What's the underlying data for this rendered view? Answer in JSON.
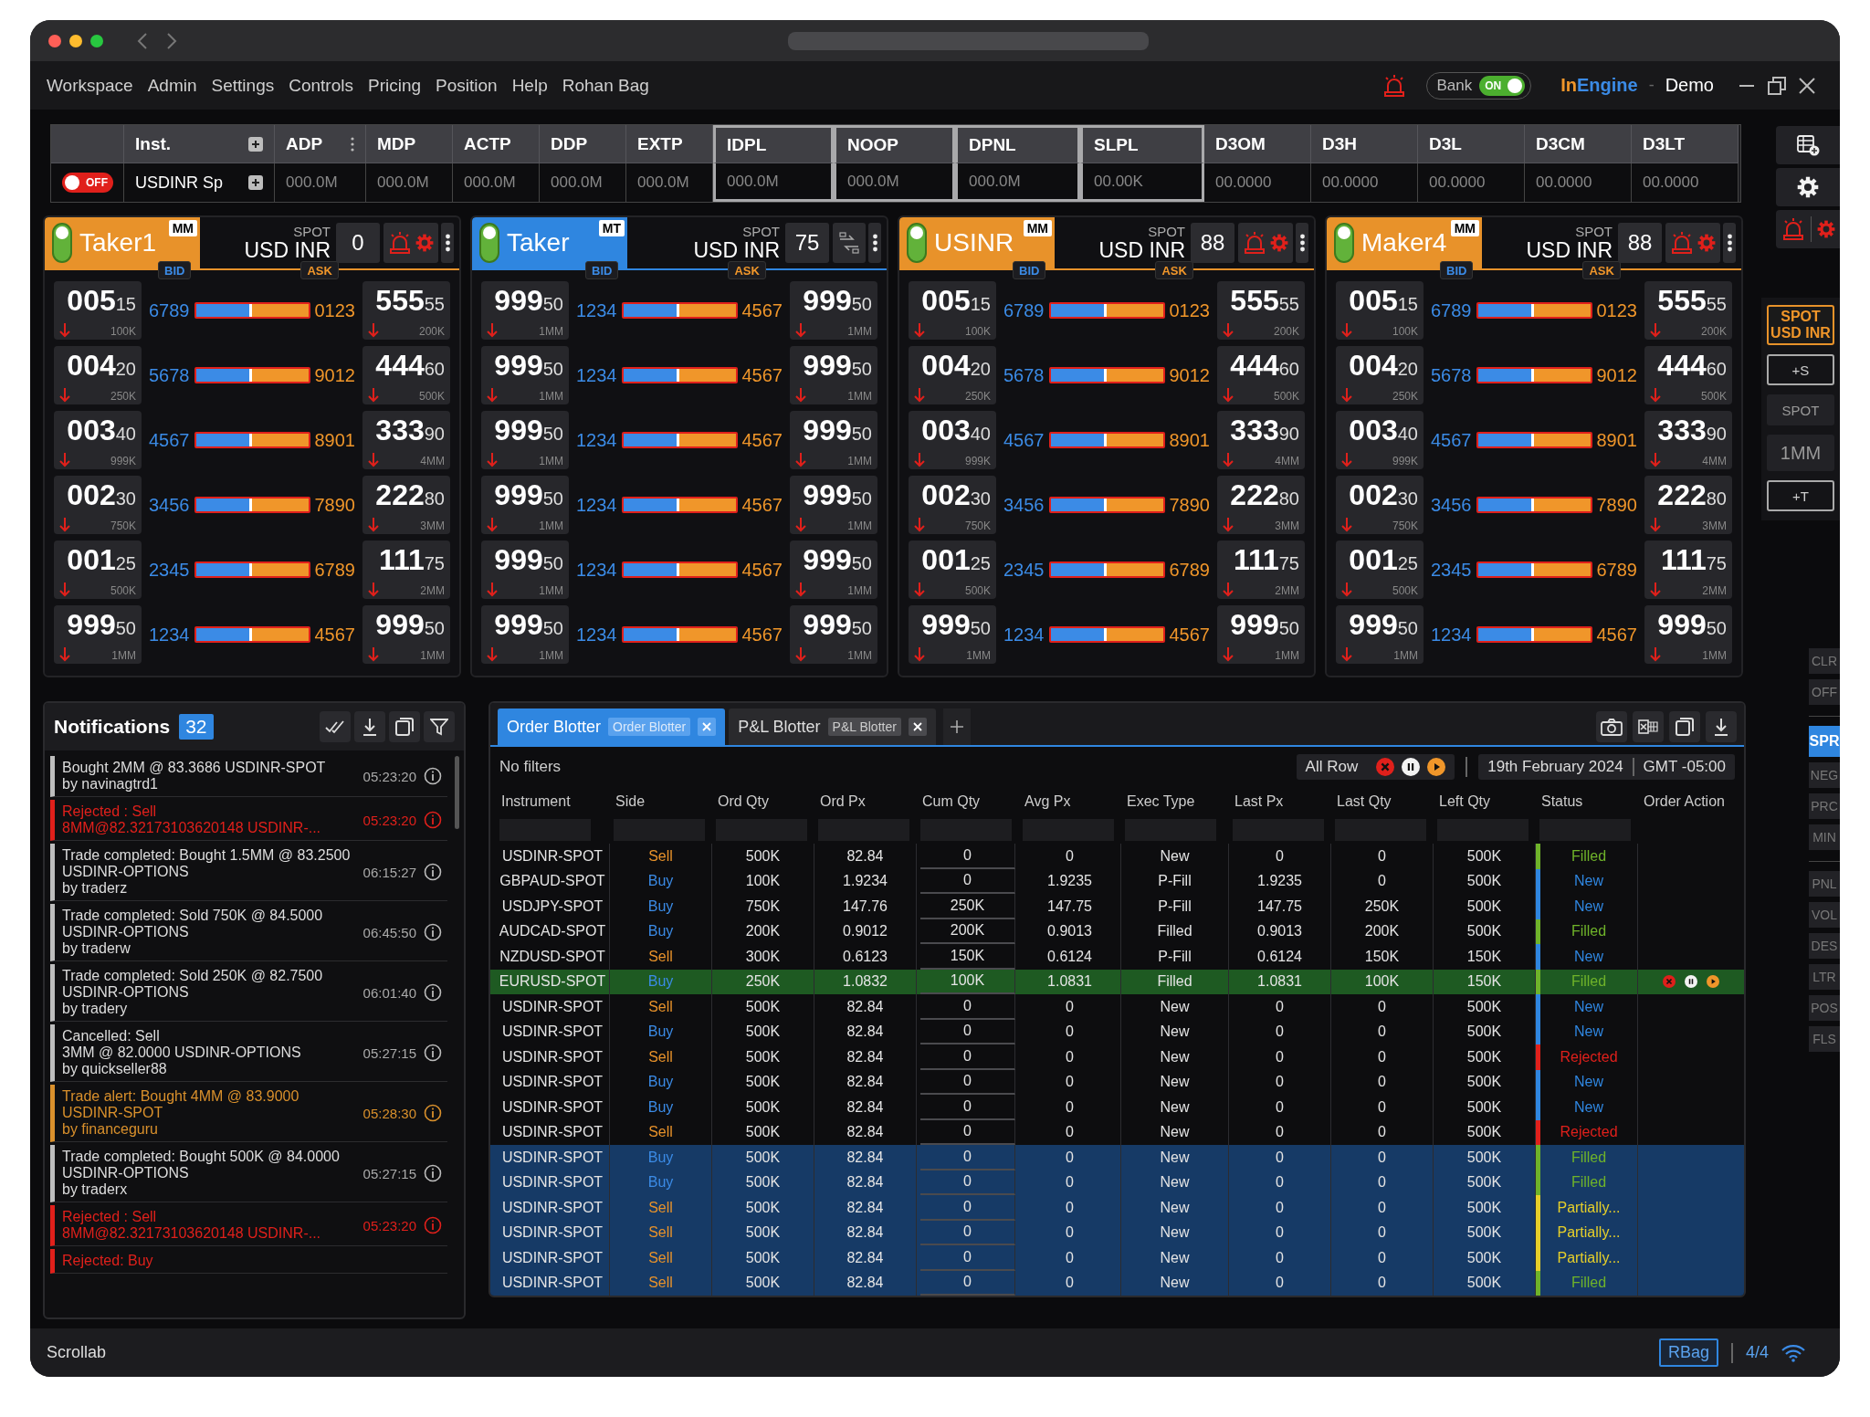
{
  "menu": [
    "Workspace",
    "Admin",
    "Settings",
    "Controls",
    "Pricing",
    "Position",
    "Help",
    "Rohan Bag"
  ],
  "header": {
    "bank_toggle": {
      "label": "Bank",
      "on": true,
      "state_label": "ON"
    },
    "brand": {
      "first": "In",
      "second": "Engine",
      "separator": "-",
      "environment": "Demo"
    }
  },
  "instrument_bar": {
    "toggle": {
      "on": false,
      "label": "OFF"
    },
    "columns": [
      {
        "label": "Inst.",
        "value": "USDINR Sp",
        "kind": "instrument",
        "boxed": false
      },
      {
        "label": "ADP",
        "value": "000.0M",
        "kind": "menu",
        "boxed": false
      },
      {
        "label": "MDP",
        "value": "000.0M",
        "kind": "plain",
        "boxed": false
      },
      {
        "label": "ACTP",
        "value": "000.0M",
        "kind": "plain",
        "boxed": false
      },
      {
        "label": "DDP",
        "value": "000.0M",
        "kind": "plain",
        "boxed": false
      },
      {
        "label": "EXTP",
        "value": "000.0M",
        "kind": "plain",
        "boxed": false
      },
      {
        "label": "IDPL",
        "value": "000.0M",
        "kind": "plain",
        "boxed": true
      },
      {
        "label": "NOOP",
        "value": "000.0M",
        "kind": "plain",
        "boxed": true
      },
      {
        "label": "DPNL",
        "value": "000.0M",
        "kind": "plain",
        "boxed": true
      },
      {
        "label": "SLPL",
        "value": "00.00K",
        "kind": "plain",
        "boxed": true
      },
      {
        "label": "D3OM",
        "value": "00.0000",
        "kind": "plain",
        "boxed": false
      },
      {
        "label": "D3H",
        "value": "00.0000",
        "kind": "plain",
        "boxed": false
      },
      {
        "label": "D3L",
        "value": "00.0000",
        "kind": "plain",
        "boxed": false
      },
      {
        "label": "D3CM",
        "value": "00.0000",
        "kind": "plain",
        "boxed": false
      },
      {
        "label": "D3LT",
        "value": "00.0000",
        "kind": "plain",
        "boxed": false
      }
    ]
  },
  "panels": [
    {
      "name": "Taker1",
      "tag": "MM",
      "color": "#e8922a",
      "product": "SPOT",
      "pair": "USD INR",
      "qty": "0",
      "kind": "alerts",
      "bid_label": "BID",
      "ask_label": "ASK",
      "rows": [
        {
          "bid": {
            "price": "005",
            "pips": "15",
            "size": "100K",
            "kind": "down"
          },
          "bid_qty": "6789",
          "level": 0.5,
          "ask_qty": "0123",
          "ask": {
            "price": "555",
            "pips": "55",
            "size": "200K",
            "kind": "down"
          }
        },
        {
          "bid": {
            "price": "004",
            "pips": "20",
            "size": "250K",
            "kind": "down"
          },
          "bid_qty": "5678",
          "level": 0.5,
          "ask_qty": "9012",
          "ask": {
            "price": "444",
            "pips": "60",
            "size": "500K",
            "kind": "down"
          }
        },
        {
          "bid": {
            "price": "003",
            "pips": "40",
            "size": "999K",
            "kind": "down"
          },
          "bid_qty": "4567",
          "level": 0.5,
          "ask_qty": "8901",
          "ask": {
            "price": "333",
            "pips": "90",
            "size": "4MM",
            "kind": "down"
          }
        },
        {
          "bid": {
            "price": "002",
            "pips": "30",
            "size": "750K",
            "kind": "down"
          },
          "bid_qty": "3456",
          "level": 0.5,
          "ask_qty": "7890",
          "ask": {
            "price": "222",
            "pips": "80",
            "size": "3MM",
            "kind": "down"
          }
        },
        {
          "bid": {
            "price": "001",
            "pips": "25",
            "size": "500K",
            "kind": "down"
          },
          "bid_qty": "2345",
          "level": 0.5,
          "ask_qty": "6789",
          "ask": {
            "price": "111",
            "pips": "75",
            "size": "2MM",
            "kind": "down"
          }
        },
        {
          "bid": {
            "price": "999",
            "pips": "50",
            "size": "1MM",
            "kind": "down"
          },
          "bid_qty": "1234",
          "level": 0.5,
          "ask_qty": "4567",
          "ask": {
            "price": "999",
            "pips": "50",
            "size": "1MM",
            "kind": "down"
          }
        }
      ]
    },
    {
      "name": "Taker",
      "tag": "MT",
      "color": "#2f86e0",
      "product": "SPOT",
      "pair": "USD INR",
      "qty": "75",
      "kind": "convert",
      "bid_label": "BID",
      "ask_label": "ASK",
      "rows": [
        {
          "bid": {
            "price": "999",
            "pips": "50",
            "size": "1MM",
            "kind": "down"
          },
          "bid_qty": "1234",
          "level": 0.5,
          "ask_qty": "4567",
          "ask": {
            "price": "999",
            "pips": "50",
            "size": "1MM",
            "kind": "down"
          }
        },
        {
          "bid": {
            "price": "999",
            "pips": "50",
            "size": "1MM",
            "kind": "down"
          },
          "bid_qty": "1234",
          "level": 0.5,
          "ask_qty": "4567",
          "ask": {
            "price": "999",
            "pips": "50",
            "size": "1MM",
            "kind": "down"
          }
        },
        {
          "bid": {
            "price": "999",
            "pips": "50",
            "size": "1MM",
            "kind": "down"
          },
          "bid_qty": "1234",
          "level": 0.5,
          "ask_qty": "4567",
          "ask": {
            "price": "999",
            "pips": "50",
            "size": "1MM",
            "kind": "down"
          }
        },
        {
          "bid": {
            "price": "999",
            "pips": "50",
            "size": "1MM",
            "kind": "down"
          },
          "bid_qty": "1234",
          "level": 0.5,
          "ask_qty": "4567",
          "ask": {
            "price": "999",
            "pips": "50",
            "size": "1MM",
            "kind": "down"
          }
        },
        {
          "bid": {
            "price": "999",
            "pips": "50",
            "size": "1MM",
            "kind": "down"
          },
          "bid_qty": "1234",
          "level": 0.5,
          "ask_qty": "4567",
          "ask": {
            "price": "999",
            "pips": "50",
            "size": "1MM",
            "kind": "down"
          }
        },
        {
          "bid": {
            "price": "999",
            "pips": "50",
            "size": "1MM",
            "kind": "down"
          },
          "bid_qty": "1234",
          "level": 0.5,
          "ask_qty": "4567",
          "ask": {
            "price": "999",
            "pips": "50",
            "size": "1MM",
            "kind": "down"
          }
        }
      ]
    },
    {
      "name": "USINR",
      "tag": "MM",
      "color": "#e8922a",
      "product": "SPOT",
      "pair": "USD INR",
      "qty": "88",
      "kind": "alerts",
      "bid_label": "BID",
      "ask_label": "ASK",
      "rows": [
        {
          "bid": {
            "price": "005",
            "pips": "15",
            "size": "100K",
            "kind": "down"
          },
          "bid_qty": "6789",
          "level": 0.5,
          "ask_qty": "0123",
          "ask": {
            "price": "555",
            "pips": "55",
            "size": "200K",
            "kind": "down"
          }
        },
        {
          "bid": {
            "price": "004",
            "pips": "20",
            "size": "250K",
            "kind": "down"
          },
          "bid_qty": "5678",
          "level": 0.5,
          "ask_qty": "9012",
          "ask": {
            "price": "444",
            "pips": "60",
            "size": "500K",
            "kind": "down"
          }
        },
        {
          "bid": {
            "price": "003",
            "pips": "40",
            "size": "999K",
            "kind": "down"
          },
          "bid_qty": "4567",
          "level": 0.5,
          "ask_qty": "8901",
          "ask": {
            "price": "333",
            "pips": "90",
            "size": "4MM",
            "kind": "down"
          }
        },
        {
          "bid": {
            "price": "002",
            "pips": "30",
            "size": "750K",
            "kind": "down"
          },
          "bid_qty": "3456",
          "level": 0.5,
          "ask_qty": "7890",
          "ask": {
            "price": "222",
            "pips": "80",
            "size": "3MM",
            "kind": "down"
          }
        },
        {
          "bid": {
            "price": "001",
            "pips": "25",
            "size": "500K",
            "kind": "down"
          },
          "bid_qty": "2345",
          "level": 0.5,
          "ask_qty": "6789",
          "ask": {
            "price": "111",
            "pips": "75",
            "size": "2MM",
            "kind": "down"
          }
        },
        {
          "bid": {
            "price": "999",
            "pips": "50",
            "size": "1MM",
            "kind": "down"
          },
          "bid_qty": "1234",
          "level": 0.5,
          "ask_qty": "4567",
          "ask": {
            "price": "999",
            "pips": "50",
            "size": "1MM",
            "kind": "down"
          }
        }
      ]
    },
    {
      "name": "Maker4",
      "tag": "MM",
      "color": "#e8922a",
      "product": "SPOT",
      "pair": "USD INR",
      "qty": "88",
      "kind": "alerts",
      "bid_label": "BID",
      "ask_label": "ASK",
      "rows": [
        {
          "bid": {
            "price": "005",
            "pips": "15",
            "size": "100K",
            "kind": "down"
          },
          "bid_qty": "6789",
          "level": 0.5,
          "ask_qty": "0123",
          "ask": {
            "price": "555",
            "pips": "55",
            "size": "200K",
            "kind": "down"
          }
        },
        {
          "bid": {
            "price": "004",
            "pips": "20",
            "size": "250K",
            "kind": "down"
          },
          "bid_qty": "5678",
          "level": 0.5,
          "ask_qty": "9012",
          "ask": {
            "price": "444",
            "pips": "60",
            "size": "500K",
            "kind": "down"
          }
        },
        {
          "bid": {
            "price": "003",
            "pips": "40",
            "size": "999K",
            "kind": "down"
          },
          "bid_qty": "4567",
          "level": 0.5,
          "ask_qty": "8901",
          "ask": {
            "price": "333",
            "pips": "90",
            "size": "4MM",
            "kind": "down"
          }
        },
        {
          "bid": {
            "price": "002",
            "pips": "30",
            "size": "750K",
            "kind": "down"
          },
          "bid_qty": "3456",
          "level": 0.5,
          "ask_qty": "7890",
          "ask": {
            "price": "222",
            "pips": "80",
            "size": "3MM",
            "kind": "down"
          }
        },
        {
          "bid": {
            "price": "001",
            "pips": "25",
            "size": "500K",
            "kind": "down"
          },
          "bid_qty": "2345",
          "level": 0.5,
          "ask_qty": "6789",
          "ask": {
            "price": "111",
            "pips": "75",
            "size": "2MM",
            "kind": "down"
          }
        },
        {
          "bid": {
            "price": "999",
            "pips": "50",
            "size": "1MM",
            "kind": "down"
          },
          "bid_qty": "1234",
          "level": 0.5,
          "ask_qty": "4567",
          "ask": {
            "price": "999",
            "pips": "50",
            "size": "1MM",
            "kind": "down"
          }
        }
      ]
    }
  ],
  "side_toolbar": {
    "pair_button": "SPOT\nUSD INR",
    "actions": [
      {
        "label": "+S",
        "kind": "outline"
      },
      {
        "label": "SPOT",
        "kind": "filled"
      },
      {
        "label": "1MM",
        "kind": "size"
      },
      {
        "label": "+T",
        "kind": "outline"
      }
    ],
    "groups": [
      {
        "buttons": [
          {
            "label": "CLR",
            "selected": false
          },
          {
            "label": "OFF",
            "selected": false
          }
        ]
      },
      {
        "buttons": [
          {
            "label": "SPR",
            "selected": true
          },
          {
            "label": "NEG",
            "selected": false
          },
          {
            "label": "PRC",
            "selected": false
          },
          {
            "label": "MIN",
            "selected": false
          }
        ]
      },
      {
        "buttons": [
          {
            "label": "PNL",
            "selected": false
          },
          {
            "label": "VOL",
            "selected": false
          },
          {
            "label": "DES",
            "selected": false
          },
          {
            "label": "LTR",
            "selected": false
          },
          {
            "label": "POS",
            "selected": false
          },
          {
            "label": "FLS",
            "selected": false
          }
        ]
      }
    ]
  },
  "notifications": {
    "title": "Notifications",
    "count": "32",
    "items": [
      {
        "message": "Bought 2MM @ 83.3686  USDINR-SPOT\nby navinagtrd1",
        "time": "05:23:20",
        "kind": "normal"
      },
      {
        "message": "Rejected : Sell\n8MM@82.32173103620148  USDINR-...",
        "time": "05:23:20",
        "kind": "error"
      },
      {
        "message": "Trade completed: Bought 1.5MM @ 83.2500\nUSDINR-OPTIONS\nby traderz",
        "time": "06:15:27",
        "kind": "normal"
      },
      {
        "message": "Trade completed: Sold 750K @ 84.5000\nUSDINR-OPTIONS\nby traderw",
        "time": "06:45:50",
        "kind": "normal"
      },
      {
        "message": "Trade completed: Sold 250K @ 82.7500\nUSDINR-OPTIONS\nby tradery",
        "time": "06:01:40",
        "kind": "normal"
      },
      {
        "message": "Cancelled: Sell\n3MM @ 82.0000 USDINR-OPTIONS\nby quickseller88",
        "time": "05:27:15",
        "kind": "normal"
      },
      {
        "message": "Trade alert: Bought 4MM @ 83.9000\nUSDINR-SPOT\nby financeguru",
        "time": "05:28:30",
        "kind": "alert"
      },
      {
        "message": "Trade completed: Bought 500K @ 84.0000\nUSDINR-OPTIONS\nby traderx",
        "time": "05:27:15",
        "kind": "normal"
      },
      {
        "message": "Rejected : Sell\n8MM@82.32173103620148  USDINR-...",
        "time": "05:23:20",
        "kind": "error"
      },
      {
        "message": "Rejected: Buy",
        "kind": "error"
      }
    ]
  },
  "blotter": {
    "tabs": [
      {
        "label": "Order Blotter",
        "badge": "Order Blotter",
        "selected": true
      },
      {
        "label": "P&L Blotter",
        "badge": "P&L Blotter",
        "selected": false
      }
    ],
    "filter_summary": "No filters",
    "row_mode": "All Row",
    "date": "19th February 2024",
    "timezone": "GMT -05:00",
    "columns": [
      "Instrument",
      "Side",
      "Ord Qty",
      "Ord Px",
      "Cum Qty",
      "Avg Px",
      "Exec Type",
      "Last Px",
      "Last Qty",
      "Left Qty",
      "Status",
      "Order Action"
    ],
    "rows": [
      {
        "cells": [
          "USDINR-SPOT",
          {
            "text": "Sell",
            "kind": "sell"
          },
          "500K",
          "82.84",
          "0",
          "0",
          "New",
          "0",
          "0",
          "500K",
          {
            "text": "Filled",
            "kind": "filled"
          }
        ],
        "focused": false,
        "selected": false
      },
      {
        "cells": [
          "GBPAUD-SPOT",
          {
            "text": "Buy",
            "kind": "buy"
          },
          "100K",
          "1.9234",
          "0",
          "1.9235",
          "P-Fill",
          "1.9235",
          "0",
          "500K",
          {
            "text": "New",
            "kind": "new"
          }
        ],
        "focused": false,
        "selected": false
      },
      {
        "cells": [
          "USDJPY-SPOT",
          {
            "text": "Buy",
            "kind": "buy"
          },
          "750K",
          "147.76",
          "250K",
          "147.75",
          "P-Fill",
          "147.75",
          "250K",
          "500K",
          {
            "text": "New",
            "kind": "new"
          }
        ],
        "focused": false,
        "selected": false
      },
      {
        "cells": [
          "AUDCAD-SPOT",
          {
            "text": "Buy",
            "kind": "buy"
          },
          "200K",
          "0.9012",
          "200K",
          "0.9013",
          "Filled",
          "0.9013",
          "200K",
          "500K",
          {
            "text": "Filled",
            "kind": "filled"
          }
        ],
        "focused": false,
        "selected": false
      },
      {
        "cells": [
          "NZDUSD-SPOT",
          {
            "text": "Sell",
            "kind": "sell"
          },
          "300K",
          "0.6123",
          "150K",
          "0.6124",
          "P-Fill",
          "0.6124",
          "150K",
          "150K",
          {
            "text": "New",
            "kind": "new"
          }
        ],
        "focused": false,
        "selected": false
      },
      {
        "cells": [
          "EURUSD-SPOT",
          {
            "text": "Buy",
            "kind": "buy"
          },
          "250K",
          "1.0832",
          "100K",
          "1.0831",
          "Filled",
          "1.0831",
          "100K",
          "150K",
          {
            "text": "Filled",
            "kind": "filled"
          }
        ],
        "focused": true,
        "selected": false
      },
      {
        "cells": [
          "USDINR-SPOT",
          {
            "text": "Sell",
            "kind": "sell"
          },
          "500K",
          "82.84",
          "0",
          "0",
          "New",
          "0",
          "0",
          "500K",
          {
            "text": "New",
            "kind": "new"
          }
        ],
        "focused": false,
        "selected": false
      },
      {
        "cells": [
          "USDINR-SPOT",
          {
            "text": "Buy",
            "kind": "buy"
          },
          "500K",
          "82.84",
          "0",
          "0",
          "New",
          "0",
          "0",
          "500K",
          {
            "text": "New",
            "kind": "new"
          }
        ],
        "focused": false,
        "selected": false
      },
      {
        "cells": [
          "USDINR-SPOT",
          {
            "text": "Sell",
            "kind": "sell"
          },
          "500K",
          "82.84",
          "0",
          "0",
          "New",
          "0",
          "0",
          "500K",
          {
            "text": "Rejected",
            "kind": "rejected"
          }
        ],
        "focused": false,
        "selected": false
      },
      {
        "cells": [
          "USDINR-SPOT",
          {
            "text": "Buy",
            "kind": "buy"
          },
          "500K",
          "82.84",
          "0",
          "0",
          "New",
          "0",
          "0",
          "500K",
          {
            "text": "New",
            "kind": "new"
          }
        ],
        "focused": false,
        "selected": false
      },
      {
        "cells": [
          "USDINR-SPOT",
          {
            "text": "Buy",
            "kind": "buy"
          },
          "500K",
          "82.84",
          "0",
          "0",
          "New",
          "0",
          "0",
          "500K",
          {
            "text": "New",
            "kind": "new"
          }
        ],
        "focused": false,
        "selected": false
      },
      {
        "cells": [
          "USDINR-SPOT",
          {
            "text": "Sell",
            "kind": "sell"
          },
          "500K",
          "82.84",
          "0",
          "0",
          "New",
          "0",
          "0",
          "500K",
          {
            "text": "Rejected",
            "kind": "rejected"
          }
        ],
        "focused": false,
        "selected": false
      },
      {
        "cells": [
          "USDINR-SPOT",
          {
            "text": "Buy",
            "kind": "buy"
          },
          "500K",
          "82.84",
          "0",
          "0",
          "New",
          "0",
          "0",
          "500K",
          {
            "text": "Filled",
            "kind": "filled"
          }
        ],
        "focused": false,
        "selected": true
      },
      {
        "cells": [
          "USDINR-SPOT",
          {
            "text": "Buy",
            "kind": "buy"
          },
          "500K",
          "82.84",
          "0",
          "0",
          "New",
          "0",
          "0",
          "500K",
          {
            "text": "Filled",
            "kind": "filled"
          }
        ],
        "focused": false,
        "selected": true
      },
      {
        "cells": [
          "USDINR-SPOT",
          {
            "text": "Sell",
            "kind": "sell"
          },
          "500K",
          "82.84",
          "0",
          "0",
          "New",
          "0",
          "0",
          "500K",
          {
            "text": "Partially...",
            "kind": "partial"
          }
        ],
        "focused": false,
        "selected": true
      },
      {
        "cells": [
          "USDINR-SPOT",
          {
            "text": "Sell",
            "kind": "sell"
          },
          "500K",
          "82.84",
          "0",
          "0",
          "New",
          "0",
          "0",
          "500K",
          {
            "text": "Partially...",
            "kind": "partial"
          }
        ],
        "focused": false,
        "selected": true
      },
      {
        "cells": [
          "USDINR-SPOT",
          {
            "text": "Sell",
            "kind": "sell"
          },
          "500K",
          "82.84",
          "0",
          "0",
          "New",
          "0",
          "0",
          "500K",
          {
            "text": "Partially...",
            "kind": "partial"
          }
        ],
        "focused": false,
        "selected": true
      },
      {
        "cells": [
          "USDINR-SPOT",
          {
            "text": "Sell",
            "kind": "sell"
          },
          "500K",
          "82.84",
          "0",
          "0",
          "New",
          "0",
          "0",
          "500K",
          {
            "text": "Filled",
            "kind": "filled"
          }
        ],
        "focused": false,
        "selected": true
      }
    ]
  },
  "status_bar": {
    "left": "Scrollab",
    "user": "RBag",
    "pages": "4/4"
  }
}
